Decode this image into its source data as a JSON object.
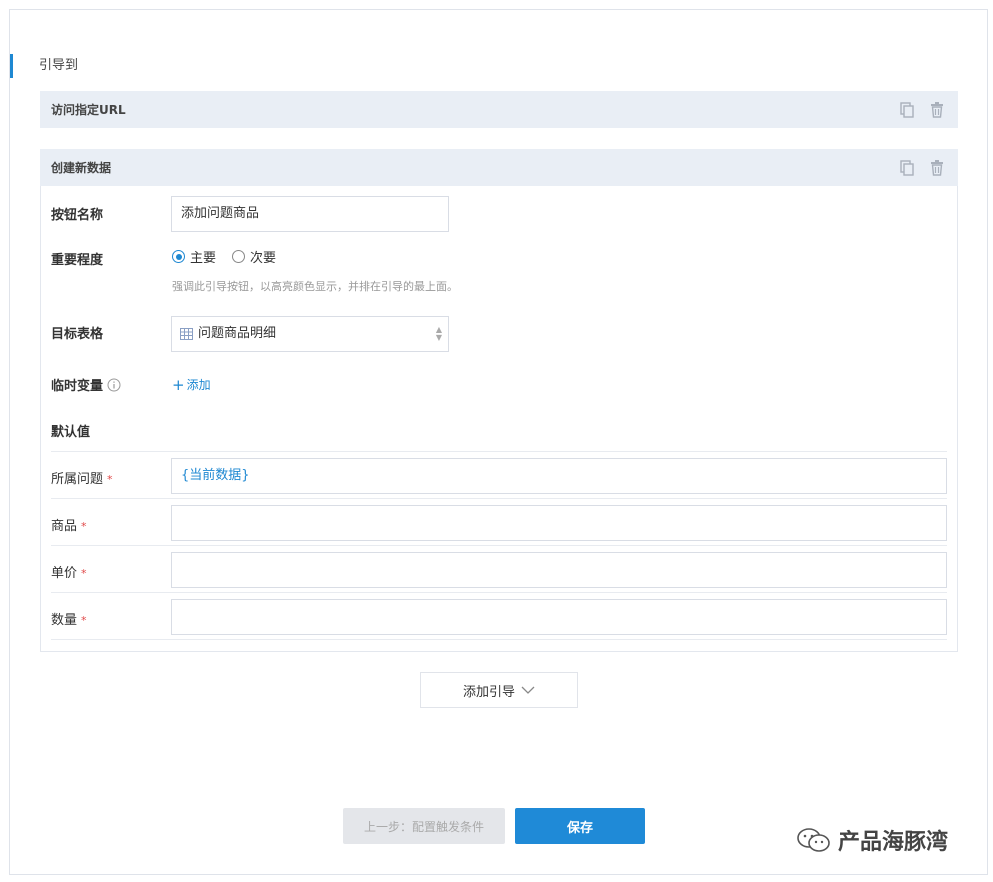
{
  "section": {
    "title": "引导到"
  },
  "cards": {
    "visit_url": {
      "title": "访问指定URL"
    },
    "create_data": {
      "title": "创建新数据",
      "button_name": {
        "label": "按钮名称",
        "value": "添加问题商品"
      },
      "importance": {
        "label": "重要程度",
        "options": [
          "主要",
          "次要"
        ],
        "selected": "主要",
        "hint": "强调此引导按钮，以高亮颜色显示，并排在引导的最上面。"
      },
      "target_table": {
        "label": "目标表格",
        "value": "问题商品明细"
      },
      "temp_vars": {
        "label": "临时变量",
        "add_label": "添加"
      },
      "defaults": {
        "label": "默认值",
        "fields": [
          {
            "label": "所属问题",
            "required": "*",
            "value": "{当前数据}"
          },
          {
            "label": "商品",
            "required": "*",
            "value": ""
          },
          {
            "label": "单价",
            "required": "*",
            "value": ""
          },
          {
            "label": "数量",
            "required": "*",
            "value": ""
          }
        ]
      }
    }
  },
  "actions": {
    "add_guide": "添加引导",
    "prev": "上一步：配置触发条件",
    "save": "保存"
  },
  "watermark": {
    "text": "产品海豚湾"
  },
  "colors": {
    "accent": "#1f8ad7",
    "required": "#e04848",
    "header_bg": "#e9eef5"
  }
}
